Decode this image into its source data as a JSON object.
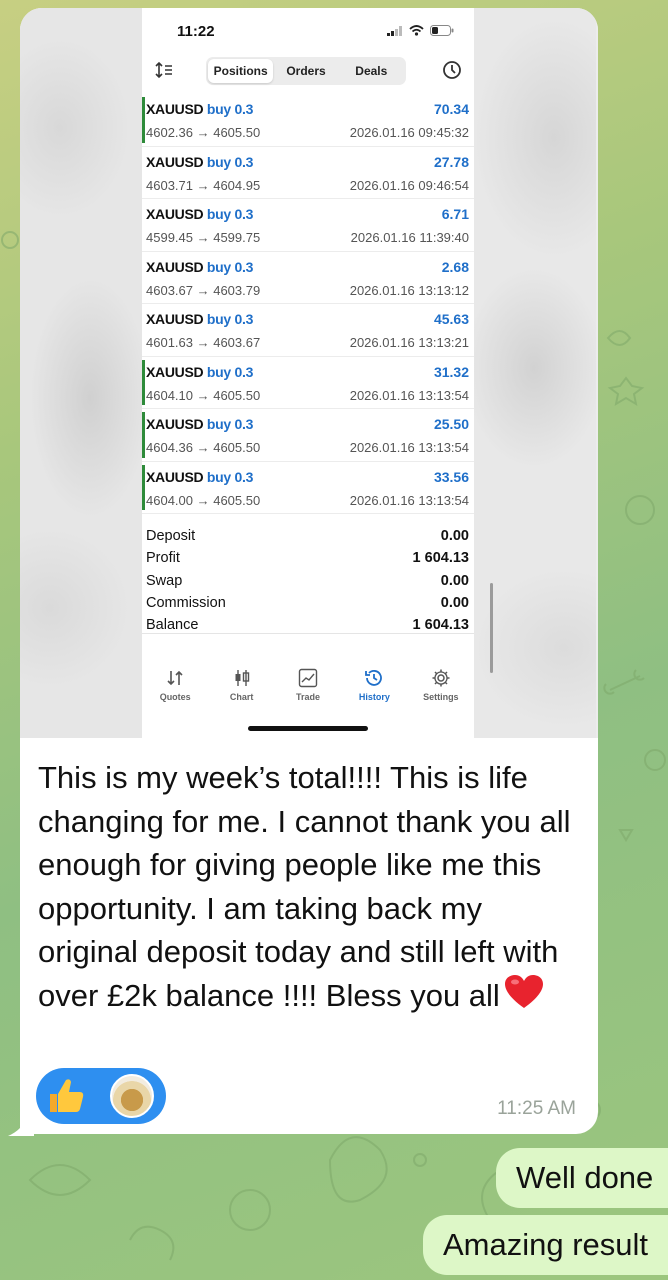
{
  "screenshot": {
    "status_time": "11:22",
    "tabs": [
      {
        "label": "Positions",
        "active": true
      },
      {
        "label": "Orders",
        "active": false
      },
      {
        "label": "Deals",
        "active": false
      }
    ],
    "trades": [
      {
        "symbol": "XAUUSD",
        "side": "buy 0.3",
        "prices": "4602.36 → 4605.50",
        "profit": "70.34",
        "time": "2026.01.16 09:45:32",
        "marked": true
      },
      {
        "symbol": "XAUUSD",
        "side": "buy 0.3",
        "prices": "4603.71 → 4604.95",
        "profit": "27.78",
        "time": "2026.01.16 09:46:54",
        "marked": false
      },
      {
        "symbol": "XAUUSD",
        "side": "buy 0.3",
        "prices": "4599.45 → 4599.75",
        "profit": "6.71",
        "time": "2026.01.16 11:39:40",
        "marked": false
      },
      {
        "symbol": "XAUUSD",
        "side": "buy 0.3",
        "prices": "4603.67 → 4603.79",
        "profit": "2.68",
        "time": "2026.01.16 13:13:12",
        "marked": false
      },
      {
        "symbol": "XAUUSD",
        "side": "buy 0.3",
        "prices": "4601.63 → 4603.67",
        "profit": "45.63",
        "time": "2026.01.16 13:13:21",
        "marked": false
      },
      {
        "symbol": "XAUUSD",
        "side": "buy 0.3",
        "prices": "4604.10 → 4605.50",
        "profit": "31.32",
        "time": "2026.01.16 13:13:54",
        "marked": true
      },
      {
        "symbol": "XAUUSD",
        "side": "buy 0.3",
        "prices": "4604.36 → 4605.50",
        "profit": "25.50",
        "time": "2026.01.16 13:13:54",
        "marked": true
      },
      {
        "symbol": "XAUUSD",
        "side": "buy 0.3",
        "prices": "4604.00 → 4605.50",
        "profit": "33.56",
        "time": "2026.01.16 13:13:54",
        "marked": true
      }
    ],
    "summary": [
      {
        "label": "Deposit",
        "value": "0.00"
      },
      {
        "label": "Profit",
        "value": "1 604.13"
      },
      {
        "label": "Swap",
        "value": "0.00"
      },
      {
        "label": "Commission",
        "value": "0.00"
      },
      {
        "label": "Balance",
        "value": "1 604.13"
      }
    ],
    "bottom_tabs": [
      {
        "label": "Quotes",
        "icon": "quotes-icon",
        "active": false
      },
      {
        "label": "Chart",
        "icon": "chart-icon",
        "active": false
      },
      {
        "label": "Trade",
        "icon": "trade-icon",
        "active": false
      },
      {
        "label": "History",
        "icon": "history-icon",
        "active": true
      },
      {
        "label": "Settings",
        "icon": "settings-icon",
        "active": false
      }
    ]
  },
  "message": {
    "text": "This is my week’s total!!!! This is life changing for me. I cannot thank you all enough for giving people like me this opportunity. I am taking back my original deposit today and still left with over £2k balance !!!! Bless you all",
    "time": "11:25 AM",
    "reactions": [
      "thumbs-up-emoji",
      "avatar"
    ]
  },
  "outgoing": [
    {
      "text": "Well done"
    },
    {
      "text": "Amazing result"
    }
  ],
  "colors": {
    "bubble_out": "#ddf7c7",
    "accent_blue": "#1f6fc9",
    "reaction_blue": "#2e8ff0",
    "marker_green": "#2e8b3a"
  }
}
